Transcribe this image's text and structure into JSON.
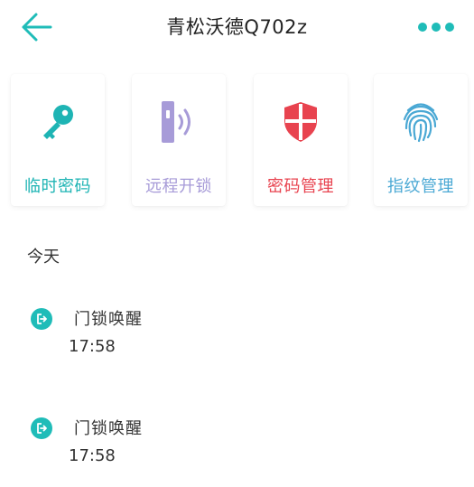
{
  "header": {
    "title": "青松沃德Q702z"
  },
  "actions": [
    {
      "label": "临时密码",
      "color": "#1eb4b4"
    },
    {
      "label": "远程开锁",
      "color": "#a79bd8"
    },
    {
      "label": "密码管理",
      "color": "#e8434f"
    },
    {
      "label": "指纹管理",
      "color": "#4aa8d4"
    }
  ],
  "colors": {
    "accent": "#1fbcb8",
    "text": "#333333"
  },
  "log": {
    "section_title": "今天",
    "items": [
      {
        "title": "门锁唤醒",
        "time": "17:58"
      },
      {
        "title": "门锁唤醒",
        "time": "17:58"
      }
    ]
  }
}
